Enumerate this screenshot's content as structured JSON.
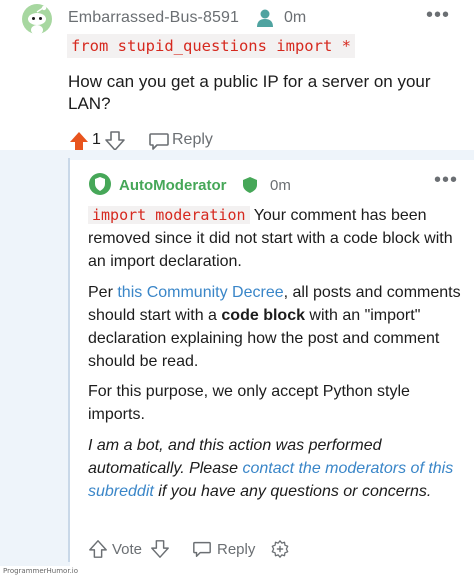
{
  "top_comment": {
    "username": "Embarrassed-Bus-8591",
    "age": "0m",
    "code": "from stupid_questions import *",
    "text": "How can you get a public IP for a server on your LAN?",
    "vote_count": "1",
    "reply_label": "Reply",
    "more_label": "•••"
  },
  "mod_comment": {
    "author": "AutoModerator",
    "age": "0m",
    "more_label": "•••",
    "p1_code": "import moderation",
    "p1_text": " Your comment has been removed since it did not start with a code block with an import declaration.",
    "p2_a": "Per ",
    "p2_link": "this Community Decree",
    "p2_b": ", all posts and comments should start with a ",
    "p2_bold": "code block",
    "p2_c": " with an \"import\" declaration explaining how the post and comment should be read.",
    "p3": "For this purpose, we only accept Python style imports.",
    "p4_a": "I am a bot, and this action was performed automatically. Please ",
    "p4_link": "contact the moderators of this subreddit",
    "p4_b": " if you have any questions or concerns.",
    "vote_label": "Vote",
    "reply_label": "Reply"
  },
  "watermark": "ProgrammerHumor.io",
  "colors": {
    "accent_orange": "#e8541d",
    "moderator_green": "#46a758",
    "link_blue": "#3a86c8",
    "code_red": "#d6291f",
    "thread_bg": "#eef4fa"
  }
}
